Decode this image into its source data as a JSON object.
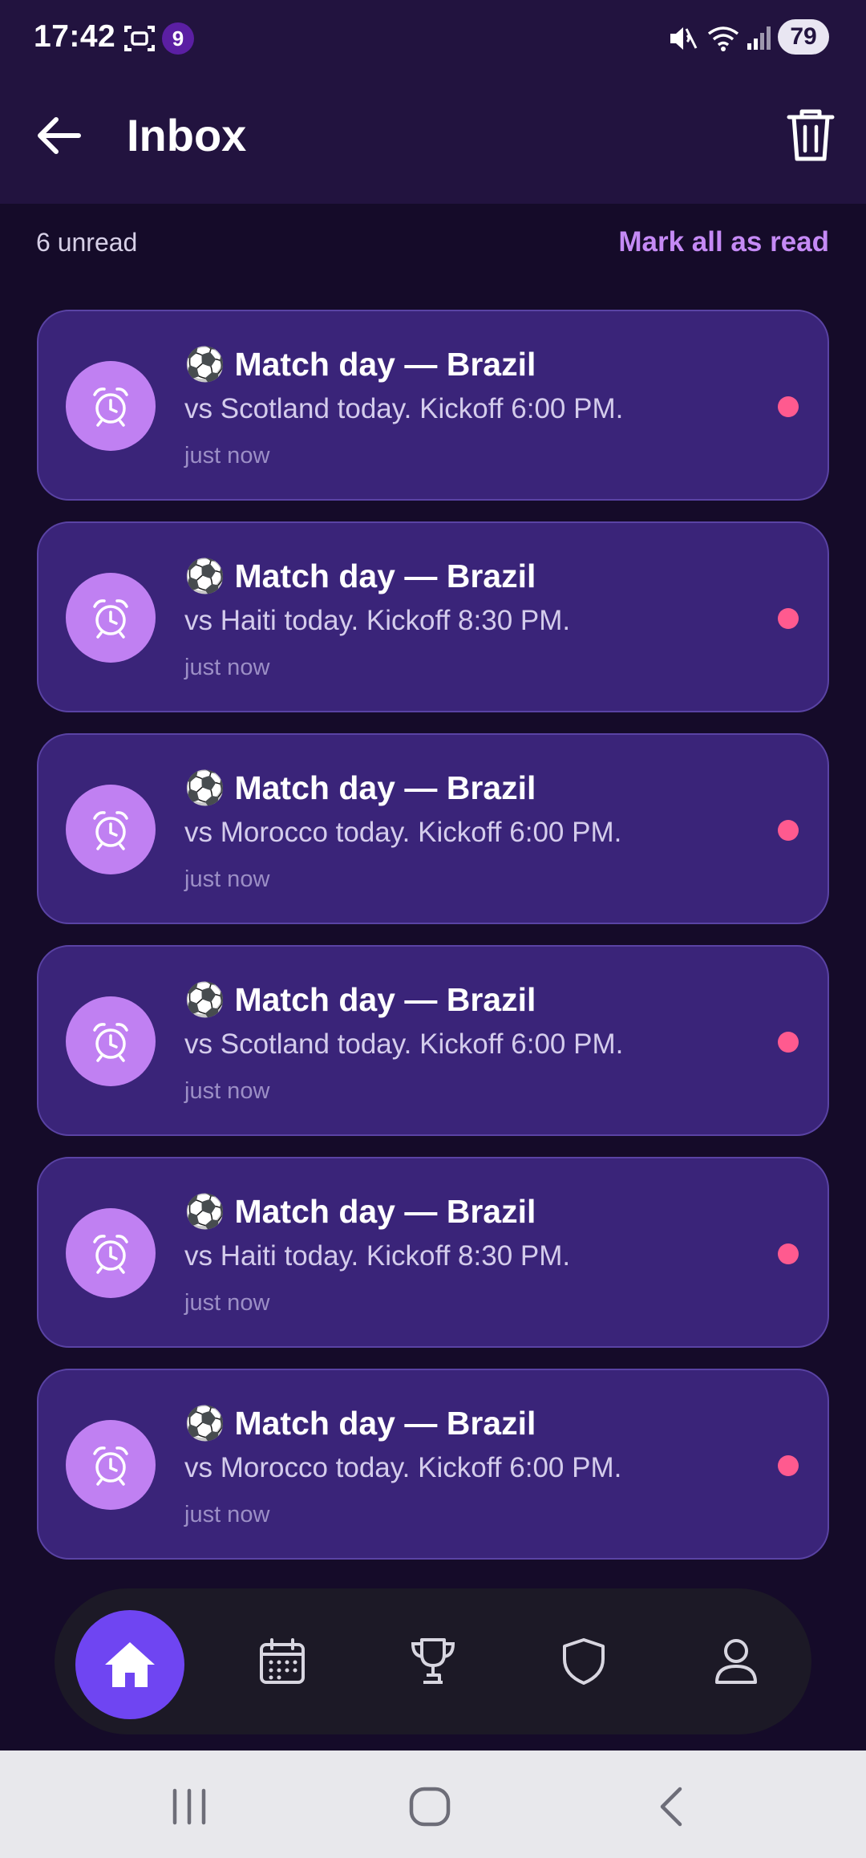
{
  "status_bar": {
    "time": "17:42",
    "notification_badge": "9",
    "battery": "79",
    "icons": [
      "screenshot-icon",
      "muted-icon",
      "wifi-icon",
      "signal-icon"
    ]
  },
  "header": {
    "title": "Inbox",
    "back_icon": "arrow-left-icon",
    "trash_icon": "trash-icon"
  },
  "summary": {
    "unread_label": "6 unread",
    "mark_all_label": "Mark all as read"
  },
  "notifications": [
    {
      "emoji": "⚽",
      "title": "Match day — Brazil",
      "body": "vs Scotland today. Kickoff 6:00 PM.",
      "time": "just now",
      "unread": true
    },
    {
      "emoji": "⚽",
      "title": "Match day — Brazil",
      "body": "vs Haiti today. Kickoff 8:30 PM.",
      "time": "just now",
      "unread": true
    },
    {
      "emoji": "⚽",
      "title": "Match day — Brazil",
      "body": "vs Morocco today. Kickoff 6:00 PM.",
      "time": "just now",
      "unread": true
    },
    {
      "emoji": "⚽",
      "title": "Match day — Brazil",
      "body": "vs Scotland today. Kickoff 6:00 PM.",
      "time": "just now",
      "unread": true
    },
    {
      "emoji": "⚽",
      "title": "Match day — Brazil",
      "body": "vs Haiti today. Kickoff 8:30 PM.",
      "time": "just now",
      "unread": true
    },
    {
      "emoji": "⚽",
      "title": "Match day — Brazil",
      "body": "vs Morocco today. Kickoff 6:00 PM.",
      "time": "just now",
      "unread": true
    }
  ],
  "bottom_nav": [
    {
      "icon": "home-icon",
      "active": true
    },
    {
      "icon": "calendar-icon",
      "active": false
    },
    {
      "icon": "trophy-icon",
      "active": false
    },
    {
      "icon": "shield-icon",
      "active": false
    },
    {
      "icon": "profile-icon",
      "active": false
    }
  ],
  "colors": {
    "background": "#150b29",
    "header": "#22133f",
    "card": "#3a2479",
    "accent": "#c58af5",
    "unread_dot": "#ff5a8f",
    "nav_active": "#6f45f2"
  }
}
